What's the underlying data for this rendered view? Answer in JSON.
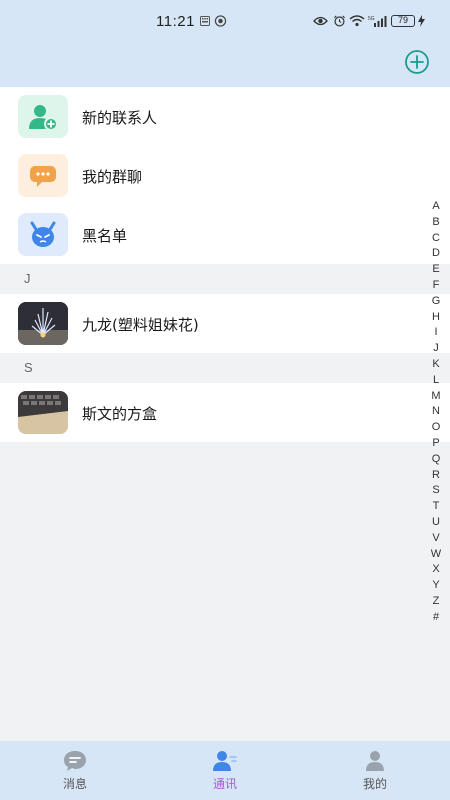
{
  "status_bar": {
    "time": "11:21",
    "battery": "79",
    "icons": [
      "keyboard-icon",
      "vpn-icon",
      "eye-icon",
      "alarm-icon",
      "wifi-icon",
      "signal-icon",
      "charging-icon"
    ]
  },
  "header": {
    "add_icon": "plus-circle-icon",
    "accent_color": "#1a9c8e"
  },
  "functions": [
    {
      "label": "新的联系人",
      "icon": "add-contact-icon",
      "color": "#34b88a"
    },
    {
      "label": "我的群聊",
      "icon": "group-chat-icon",
      "color": "#f2a24a"
    },
    {
      "label": "黑名单",
      "icon": "blacklist-devil-icon",
      "color": "#3f86e8"
    }
  ],
  "groups": [
    {
      "letter": "J",
      "contacts": [
        {
          "name": "九龙(塑料姐妹花)",
          "avatar": "fireworks-photo"
        }
      ]
    },
    {
      "letter": "S",
      "contacts": [
        {
          "name": "斯文的方盒",
          "avatar": "keyboard-photo"
        }
      ]
    }
  ],
  "index_letters": [
    "A",
    "B",
    "C",
    "D",
    "E",
    "F",
    "G",
    "H",
    "I",
    "J",
    "K",
    "L",
    "M",
    "N",
    "O",
    "P",
    "Q",
    "R",
    "S",
    "T",
    "U",
    "V",
    "W",
    "X",
    "Y",
    "Z",
    "#"
  ],
  "tabs": [
    {
      "label": "消息",
      "icon": "chat-bubble-icon",
      "active": false
    },
    {
      "label": "通讯",
      "icon": "contacts-icon",
      "active": true
    },
    {
      "label": "我的",
      "icon": "profile-icon",
      "active": false
    }
  ],
  "colors": {
    "header_bg": "#d7e6f6",
    "active_tab": "#a45bd6",
    "page_bg": "#f1f2f4"
  }
}
